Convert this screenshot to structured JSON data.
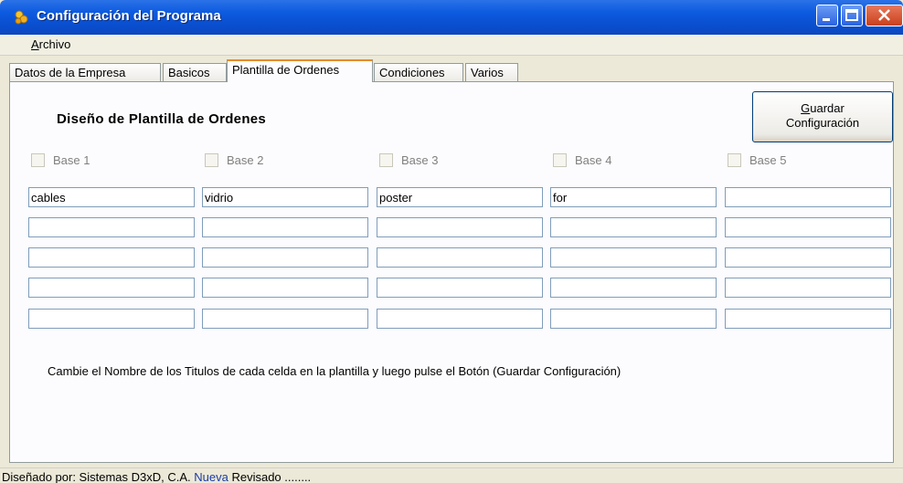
{
  "window": {
    "title": "Configuración del Programa"
  },
  "menu": {
    "items": [
      "Archivo"
    ]
  },
  "tabs": [
    "Datos de la Empresa",
    "Basicos",
    "Plantilla de Ordenes",
    "Condiciones",
    "Varios"
  ],
  "active_tab": "Plantilla de Ordenes",
  "panel": {
    "heading": "Diseño de Plantilla de Ordenes",
    "save_button": {
      "line1": "Guardar",
      "line2": "Configuración"
    },
    "checkboxes": [
      {
        "label": "Base 1",
        "checked": false
      },
      {
        "label": "Base 2",
        "checked": false
      },
      {
        "label": "Base 3",
        "checked": false
      },
      {
        "label": "Base 4",
        "checked": false
      },
      {
        "label": "Base 5",
        "checked": false
      }
    ],
    "grid": [
      [
        "cables",
        "vidrio",
        "poster",
        "for",
        ""
      ],
      [
        "",
        "",
        "",
        "",
        ""
      ],
      [
        "",
        "",
        "",
        "",
        ""
      ],
      [
        "",
        "",
        "",
        "",
        ""
      ],
      [
        "",
        "",
        "",
        "",
        ""
      ]
    ],
    "instructions": "Cambie el Nombre de los Titulos de cada celda en la plantilla y luego pulse el Botón (Guardar Configuración)"
  },
  "status": {
    "prefix": "Diseñado por: Sistemas D3xD, C.A.",
    "nueva": "Nueva",
    "suffix": "Revisado ........"
  },
  "colors": {
    "titlebar": "#0a4fd0",
    "tab_highlight": "#e68b2c",
    "field_border": "#7f9db9"
  }
}
